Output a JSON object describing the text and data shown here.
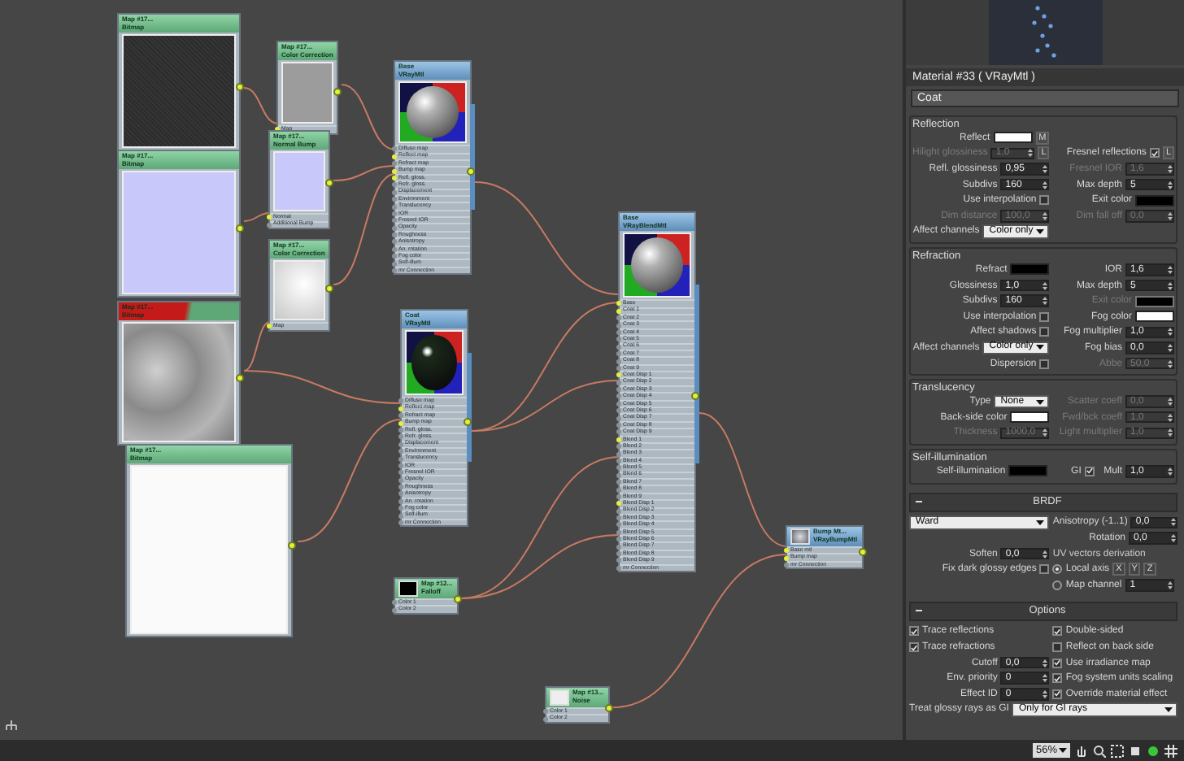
{
  "nodes": [
    {
      "kind": "map",
      "highlighted": false,
      "title": [
        "Map #17...",
        "Bitmap"
      ],
      "preview": {
        "kind": "dark"
      }
    },
    {
      "kind": "map",
      "highlighted": false,
      "title": [
        "Map #17...",
        "Bitmap"
      ],
      "preview": {
        "kind": "lavender"
      }
    },
    {
      "kind": "map",
      "highlighted": true,
      "title": [
        "Map #17...",
        "Bitmap"
      ],
      "preview": {
        "kind": "grey-noise"
      }
    },
    {
      "kind": "map",
      "highlighted": false,
      "title": [
        "Map #17...",
        "Bitmap"
      ],
      "preview": {
        "kind": "white"
      }
    },
    {
      "kind": "map",
      "highlighted": false,
      "title": [
        "Map #17...",
        "Color Correction"
      ],
      "preview": {
        "kind": "grey"
      },
      "slots": [
        {
          "label": "Map",
          "linked": true
        }
      ]
    },
    {
      "kind": "map",
      "highlighted": false,
      "title": [
        "Map #17...",
        "Normal Bump"
      ],
      "preview": {
        "kind": "lavender"
      },
      "slots": [
        {
          "label": "Normal",
          "linked": true
        },
        {
          "label": "Additional Bump",
          "linked": false
        }
      ]
    },
    {
      "kind": "map",
      "highlighted": false,
      "title": [
        "Map #17...",
        "Color Correction"
      ],
      "preview": {
        "kind": "white-noise"
      },
      "slots": [
        {
          "label": "Map",
          "linked": true
        }
      ]
    },
    {
      "kind": "material",
      "highlighted": false,
      "title": [
        "Base",
        "VRayMtl"
      ],
      "preview": {
        "kind": "sphere"
      },
      "slots": [
        {
          "label": "Diffuse map",
          "linked": false
        },
        {
          "label": "Reflect map",
          "linked": true
        },
        {
          "label": "Refract map",
          "linked": false
        },
        {
          "label": "Bump map",
          "linked": true
        },
        {
          "label": "Refl. gloss.",
          "linked": true
        },
        {
          "label": "Refr. gloss.",
          "linked": false
        },
        {
          "label": "Displacement",
          "linked": false
        },
        {
          "label": "Environment",
          "linked": false
        },
        {
          "label": "Translucency",
          "linked": false
        },
        {
          "label": "IOR",
          "linked": false
        },
        {
          "label": "Fresnel IOR",
          "linked": false
        },
        {
          "label": "Opacity",
          "linked": false
        },
        {
          "label": "Roughness",
          "linked": false
        },
        {
          "label": "Anisotropy",
          "linked": false
        },
        {
          "label": "An. rotation",
          "linked": false
        },
        {
          "label": "Fog color",
          "linked": false
        },
        {
          "label": "Self-illum",
          "linked": false
        },
        {
          "label": "mr Connection",
          "linked": false
        }
      ]
    },
    {
      "kind": "material",
      "highlighted": false,
      "title": [
        "Coat",
        "VRayMtl"
      ],
      "preview": {
        "kind": "dark-sphere"
      },
      "slots": [
        {
          "label": "Diffuse map",
          "linked": false
        },
        {
          "label": "Reflect map",
          "linked": true
        },
        {
          "label": "Refract map",
          "linked": false
        },
        {
          "label": "Bump map",
          "linked": true
        },
        {
          "label": "Refl. gloss.",
          "linked": false
        },
        {
          "label": "Refr. gloss.",
          "linked": false
        },
        {
          "label": "Displacement",
          "linked": false
        },
        {
          "label": "Environment",
          "linked": false
        },
        {
          "label": "Translucency",
          "linked": false
        },
        {
          "label": "IOR",
          "linked": false
        },
        {
          "label": "Fresnel IOR",
          "linked": false
        },
        {
          "label": "Opacity",
          "linked": false
        },
        {
          "label": "Roughness",
          "linked": false
        },
        {
          "label": "Anisotropy",
          "linked": false
        },
        {
          "label": "An. rotation",
          "linked": false
        },
        {
          "label": "Fog color",
          "linked": false
        },
        {
          "label": "Self-illum",
          "linked": false
        },
        {
          "label": "mr Connection",
          "linked": false
        }
      ]
    },
    {
      "kind": "material",
      "highlighted": false,
      "title": [
        "Base",
        "VRayBlendMtl"
      ],
      "preview": {
        "kind": "sphere"
      },
      "slots": [
        {
          "label": "Base",
          "linked": true
        },
        {
          "label": "Coat 1",
          "linked": true
        },
        {
          "label": "Coat 2",
          "linked": false
        },
        {
          "label": "Coat 3",
          "linked": false
        },
        {
          "label": "Coat 4",
          "linked": false
        },
        {
          "label": "Coat 5",
          "linked": false
        },
        {
          "label": "Coat 6",
          "linked": false
        },
        {
          "label": "Coat 7",
          "linked": false
        },
        {
          "label": "Coat 8",
          "linked": false
        },
        {
          "label": "Coat 9",
          "linked": false
        },
        {
          "label": "Coat Disp 1",
          "linked": true
        },
        {
          "label": "Coat Disp 2",
          "linked": false
        },
        {
          "label": "Coat Disp 3",
          "linked": false
        },
        {
          "label": "Coat Disp 4",
          "linked": false
        },
        {
          "label": "Coat Disp 5",
          "linked": false
        },
        {
          "label": "Coat Disp 6",
          "linked": false
        },
        {
          "label": "Coat Disp 7",
          "linked": false
        },
        {
          "label": "Coat Disp 8",
          "linked": false
        },
        {
          "label": "Coat Disp 9",
          "linked": false
        },
        {
          "label": "Blend 1",
          "linked": true
        },
        {
          "label": "Blend 2",
          "linked": false
        },
        {
          "label": "Blend 3",
          "linked": false
        },
        {
          "label": "Blend 4",
          "linked": false
        },
        {
          "label": "Blend 5",
          "linked": false
        },
        {
          "label": "Blend 6",
          "linked": false
        },
        {
          "label": "Blend 7",
          "linked": false
        },
        {
          "label": "Blend 8",
          "linked": false
        },
        {
          "label": "Blend 9",
          "linked": false
        },
        {
          "label": "Blend Disp 1",
          "linked": true
        },
        {
          "label": "Blend Disp 2",
          "linked": false
        },
        {
          "label": "Blend Disp 3",
          "linked": false
        },
        {
          "label": "Blend Disp 4",
          "linked": false
        },
        {
          "label": "Blend Disp 5",
          "linked": false
        },
        {
          "label": "Blend Disp 6",
          "linked": false
        },
        {
          "label": "Blend Disp 7",
          "linked": false
        },
        {
          "label": "Blend Disp 8",
          "linked": false
        },
        {
          "label": "Blend Disp 9",
          "linked": false
        },
        {
          "label": "mr Connection",
          "linked": false
        }
      ]
    },
    {
      "kind": "map",
      "highlighted": false,
      "title": [
        "Map #12...",
        "Falloff"
      ],
      "preview": {
        "kind": "black-thumb"
      },
      "slots": [
        {
          "label": "Color 1",
          "linked": false
        },
        {
          "label": "Color 2",
          "linked": false
        }
      ]
    },
    {
      "kind": "map",
      "highlighted": false,
      "title": [
        "Map #13...",
        "Noise"
      ],
      "preview": {
        "kind": "white-thumb"
      },
      "slots": [
        {
          "label": "Color 1",
          "linked": false
        },
        {
          "label": "Color 2",
          "linked": false
        }
      ]
    },
    {
      "kind": "material",
      "highlighted": false,
      "title": [
        "Bump Mt...",
        "VRayBumpMtl"
      ],
      "preview": {
        "kind": "sphere-thumb"
      },
      "slots": [
        {
          "label": "Base mtl",
          "linked": true
        },
        {
          "label": "Bump map",
          "linked": true
        },
        {
          "label": "mr Connection",
          "linked": false
        }
      ]
    }
  ],
  "zoom": "56%",
  "panel": {
    "title": "Material #33  ( VRayMtl )",
    "material_name": "Coat",
    "sections": [
      {
        "kind": "group",
        "title": "Reflection",
        "rows": [
          [
            {
              "kind": "color",
              "label": "Reflect",
              "color": "#ffffff",
              "suffix": "M",
              "disabled": false
            },
            null
          ],
          [
            {
              "kind": "spinner",
              "label": "Hilight glossiness",
              "value": "1,0",
              "suffix": "L",
              "disabled": true
            },
            {
              "kind": "check",
              "label": "Fresnel reflections",
              "checked": true,
              "suffix": "L",
              "disabled": false
            }
          ],
          [
            {
              "kind": "spinner",
              "label": "Refl. glossiness",
              "value": "0,95",
              "disabled": false
            },
            {
              "kind": "spinner",
              "label": "Fresnel IOR",
              "value": "1,6",
              "disabled": true
            }
          ],
          [
            {
              "kind": "spinner",
              "label": "Subdivs",
              "value": "160",
              "disabled": false
            },
            {
              "kind": "spinner",
              "label": "Max depth",
              "value": "5",
              "disabled": false
            }
          ],
          [
            {
              "kind": "check",
              "label": "Use interpolation",
              "checked": false,
              "disabled": false
            },
            {
              "kind": "color",
              "label": "Exit color",
              "color": "#000000",
              "disabled": false
            }
          ],
          [
            {
              "kind": "spinner",
              "label": "Dim distance",
              "value": "100,0",
              "disabled": true
            },
            {
              "kind": "spinner",
              "label": "Dim fall off",
              "value": "0,0",
              "disabled": true
            }
          ],
          [
            {
              "kind": "dropdown",
              "label": "Affect channels",
              "value": "Color only",
              "disabled": false
            },
            null
          ]
        ]
      },
      {
        "kind": "group",
        "title": "Refraction",
        "rows": [
          [
            {
              "kind": "color",
              "label": "Refract",
              "color": "#000000",
              "disabled": false
            },
            {
              "kind": "spinner",
              "label": "IOR",
              "value": "1,6",
              "disabled": false
            }
          ],
          [
            {
              "kind": "spinner",
              "label": "Glossiness",
              "value": "1,0",
              "disabled": false
            },
            {
              "kind": "spinner",
              "label": "Max depth",
              "value": "5",
              "disabled": false
            }
          ],
          [
            {
              "kind": "spinner",
              "label": "Subdivs",
              "value": "160",
              "disabled": false
            },
            {
              "kind": "color",
              "label": "Exit color",
              "color": "#000000",
              "disabled": true
            }
          ],
          [
            {
              "kind": "check",
              "label": "Use interpolation",
              "checked": false,
              "disabled": false
            },
            {
              "kind": "color",
              "label": "Fog color",
              "color": "#ffffff",
              "disabled": false
            }
          ],
          [
            {
              "kind": "check",
              "label": "Affect shadows",
              "checked": false,
              "disabled": false
            },
            {
              "kind": "spinner",
              "label": "Fog multiplier",
              "value": "1,0",
              "disabled": false
            }
          ],
          [
            {
              "kind": "dropdown",
              "label": "Affect channels",
              "value": "Color only",
              "disabled": false
            },
            {
              "kind": "spinner",
              "label": "Fog bias",
              "value": "0,0",
              "disabled": false
            }
          ],
          [
            {
              "kind": "check",
              "label": "Dispersion",
              "checked": false,
              "disabled": false
            },
            {
              "kind": "spinner",
              "label": "Abbe",
              "value": "50,0",
              "disabled": true
            }
          ]
        ]
      },
      {
        "kind": "group",
        "title": "Translucency",
        "rows": [
          [
            {
              "kind": "dropdown",
              "label": "Type",
              "value": "None",
              "disabled": false
            },
            {
              "kind": "spinner",
              "label": "Scatter coeff",
              "value": "0,0",
              "disabled": true
            }
          ],
          [
            {
              "kind": "color",
              "label": "Back-side color",
              "color": "#ffffff",
              "disabled": false
            },
            {
              "kind": "spinner",
              "label": "Fwd/bck coeff",
              "value": "1,0",
              "disabled": true
            }
          ],
          [
            {
              "kind": "spinner",
              "label": "Thickness",
              "value": "1000,0",
              "disabled": true
            },
            {
              "kind": "spinner",
              "label": "Light multiplier",
              "value": "1,0",
              "disabled": true
            }
          ]
        ]
      },
      {
        "kind": "group",
        "title": "Self-illumination",
        "rows": [
          [
            {
              "kind": "color",
              "label": "Self-illumination",
              "color": "#000000",
              "disabled": false
            },
            {
              "kind": "check",
              "label": "GI",
              "checked": true,
              "disabled": false
            },
            {
              "kind": "spinner",
              "label": "Mult",
              "value": "1,0",
              "disabled": false
            }
          ]
        ]
      },
      {
        "kind": "rollout",
        "title": "BRDF",
        "rows": [
          [
            {
              "kind": "wide-dropdown",
              "value": "Ward",
              "disabled": false
            },
            {
              "kind": "spinner",
              "label": "Anisotropy (-1..1)",
              "value": "0,0",
              "disabled": false
            }
          ],
          [
            null,
            {
              "kind": "spinner",
              "label": "Rotation",
              "value": "0,0",
              "disabled": false
            }
          ],
          [
            {
              "kind": "spinner",
              "label": "Soften",
              "value": "0,0",
              "disabled": false
            },
            {
              "kind": "caption",
              "label": "UV vectors derivation"
            }
          ],
          [
            {
              "kind": "check",
              "label": "Fix dark glossy edges",
              "checked": false,
              "disabled": false
            },
            {
              "kind": "radio",
              "label": "Local axis",
              "selected": true,
              "buttons": [
                "X",
                "Y",
                "Z"
              ],
              "disabled": false
            }
          ],
          [
            null,
            {
              "kind": "radio",
              "label": "Map channel",
              "selected": false,
              "value": "1",
              "disabled": false
            }
          ]
        ]
      },
      {
        "kind": "rollout",
        "title": "Options",
        "rows": [
          [
            {
              "kind": "option",
              "label": "Trace reflections",
              "checked": true,
              "disabled": false
            },
            {
              "kind": "option",
              "label": "Double-sided",
              "checked": true,
              "disabled": false
            }
          ],
          [
            {
              "kind": "option",
              "label": "Trace refractions",
              "checked": true,
              "disabled": false
            },
            {
              "kind": "option",
              "label": "Reflect on back side",
              "checked": false,
              "disabled": false
            }
          ],
          [
            {
              "kind": "spinner",
              "label": "Cutoff",
              "value": "0,0",
              "disabled": false
            },
            {
              "kind": "option",
              "label": "Use irradiance map",
              "checked": true,
              "disabled": false
            }
          ],
          [
            {
              "kind": "spinner",
              "label": "Env. priority",
              "value": "0",
              "disabled": false
            },
            {
              "kind": "option",
              "label": "Fog system units scaling",
              "checked": true,
              "disabled": false
            }
          ],
          [
            {
              "kind": "spinner",
              "label": "Effect ID",
              "value": "0",
              "disabled": false
            },
            {
              "kind": "option",
              "label": "Override material effect",
              "checked": true,
              "disabled": false
            }
          ],
          [
            {
              "kind": "wide-dropdown",
              "label": "Treat glossy rays as GI",
              "value": "Only for GI rays",
              "disabled": false
            }
          ]
        ]
      }
    ]
  }
}
